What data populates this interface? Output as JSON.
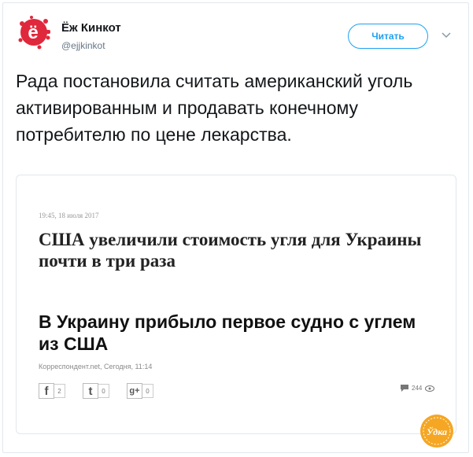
{
  "account": {
    "name": "Ёж Кинкот",
    "handle": "@ejjkinkot",
    "follow_label": "Читать",
    "avatar_letter": "ё",
    "avatar_color": "#e0283c"
  },
  "tweet": {
    "text": "Рада постановила считать американский уголь активированным и продавать конечному потребителю по цене лекарства."
  },
  "card": {
    "date": "19:45, 18 июля 2017",
    "headline_top": "США увеличили стоимость угля для Украины почти в три раза",
    "headline_bottom": "В Украину прибыло первое судно с углем из США",
    "source": "Корреспондент.net, Сегодня, 11:14",
    "shares": [
      {
        "icon": "f",
        "count": "2"
      },
      {
        "icon": "t",
        "count": "0"
      },
      {
        "icon": "g+",
        "count": "0"
      }
    ],
    "comments_count": "244"
  },
  "watermark": {
    "text": "Ўдка",
    "color": "#f5a623"
  }
}
